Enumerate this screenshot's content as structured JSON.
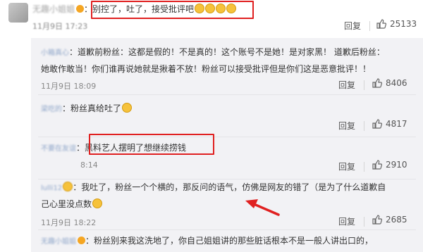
{
  "top_comment": {
    "username": "无趣小姐姐",
    "text": "：别控了，吐了，接受批评吧",
    "date": "11月9日 17:23",
    "reply_label": "回复",
    "likes": "25133"
  },
  "replies": [
    {
      "username": "小箱真心",
      "line1": "：道歉前粉丝：这都是假的！不是真的！这个账号不是她！是对家黑！ 道歉后粉丝：",
      "line2": "她敢作敢当！你们谁再说她就是揪着不放！粉丝可以接受批评但是你们这是恶意批评！！",
      "date": "11月9日 18:09",
      "reply_label": "回复",
      "likes": "8406"
    },
    {
      "username": "梁吃的",
      "text": "：粉丝真给吐了",
      "date": "",
      "reply_label": "回复",
      "likes": "4817"
    },
    {
      "username": "不要在友谊",
      "text": "：黑料艺人摆明了想继续捞钱",
      "date": "8:14",
      "reply_label": "回复",
      "likes": "2910"
    },
    {
      "username": "lulli12",
      "line1": "：我吐了，粉丝一个个横的，那反问的语气，仿佛是网友的错了（是为了什么道歉自",
      "line2": "己心里没点数",
      "date": "11月9日 18:22",
      "reply_label": "回复",
      "likes": "2685"
    },
    {
      "username": "无趣小姐姐",
      "text": "：粉丝别来我这洗地了，你自己姐姐讲的那些脏话根本不是一般人讲出口的，",
      "date": "",
      "reply_label": "",
      "likes": ""
    }
  ],
  "colors": {
    "highlight": "#e02020",
    "reply_bg": "#f2f2f5",
    "username": "#8fa6c9"
  }
}
